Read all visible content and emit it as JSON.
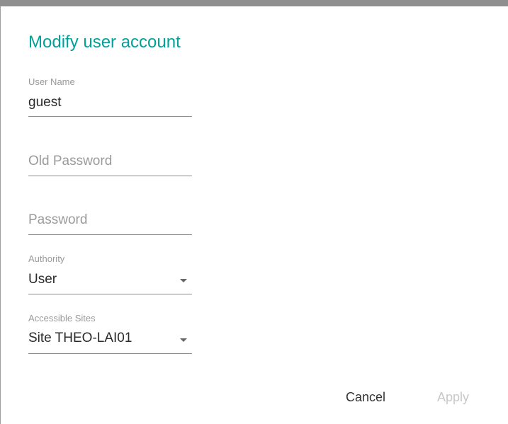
{
  "dialog": {
    "title": "Modify user account"
  },
  "fields": {
    "username": {
      "label": "User Name",
      "value": "guest"
    },
    "old_password": {
      "placeholder": "Old Password"
    },
    "password": {
      "placeholder": "Password"
    },
    "authority": {
      "label": "Authority",
      "value": "User"
    },
    "accessible_sites": {
      "label": "Accessible Sites",
      "value": "Site THEO-LAI01"
    }
  },
  "buttons": {
    "cancel": "Cancel",
    "apply": "Apply"
  },
  "colors": {
    "title": "#00a29a",
    "label": "#9a9a9a",
    "text": "#2b2b2b",
    "disabled": "#c8c8c8"
  }
}
